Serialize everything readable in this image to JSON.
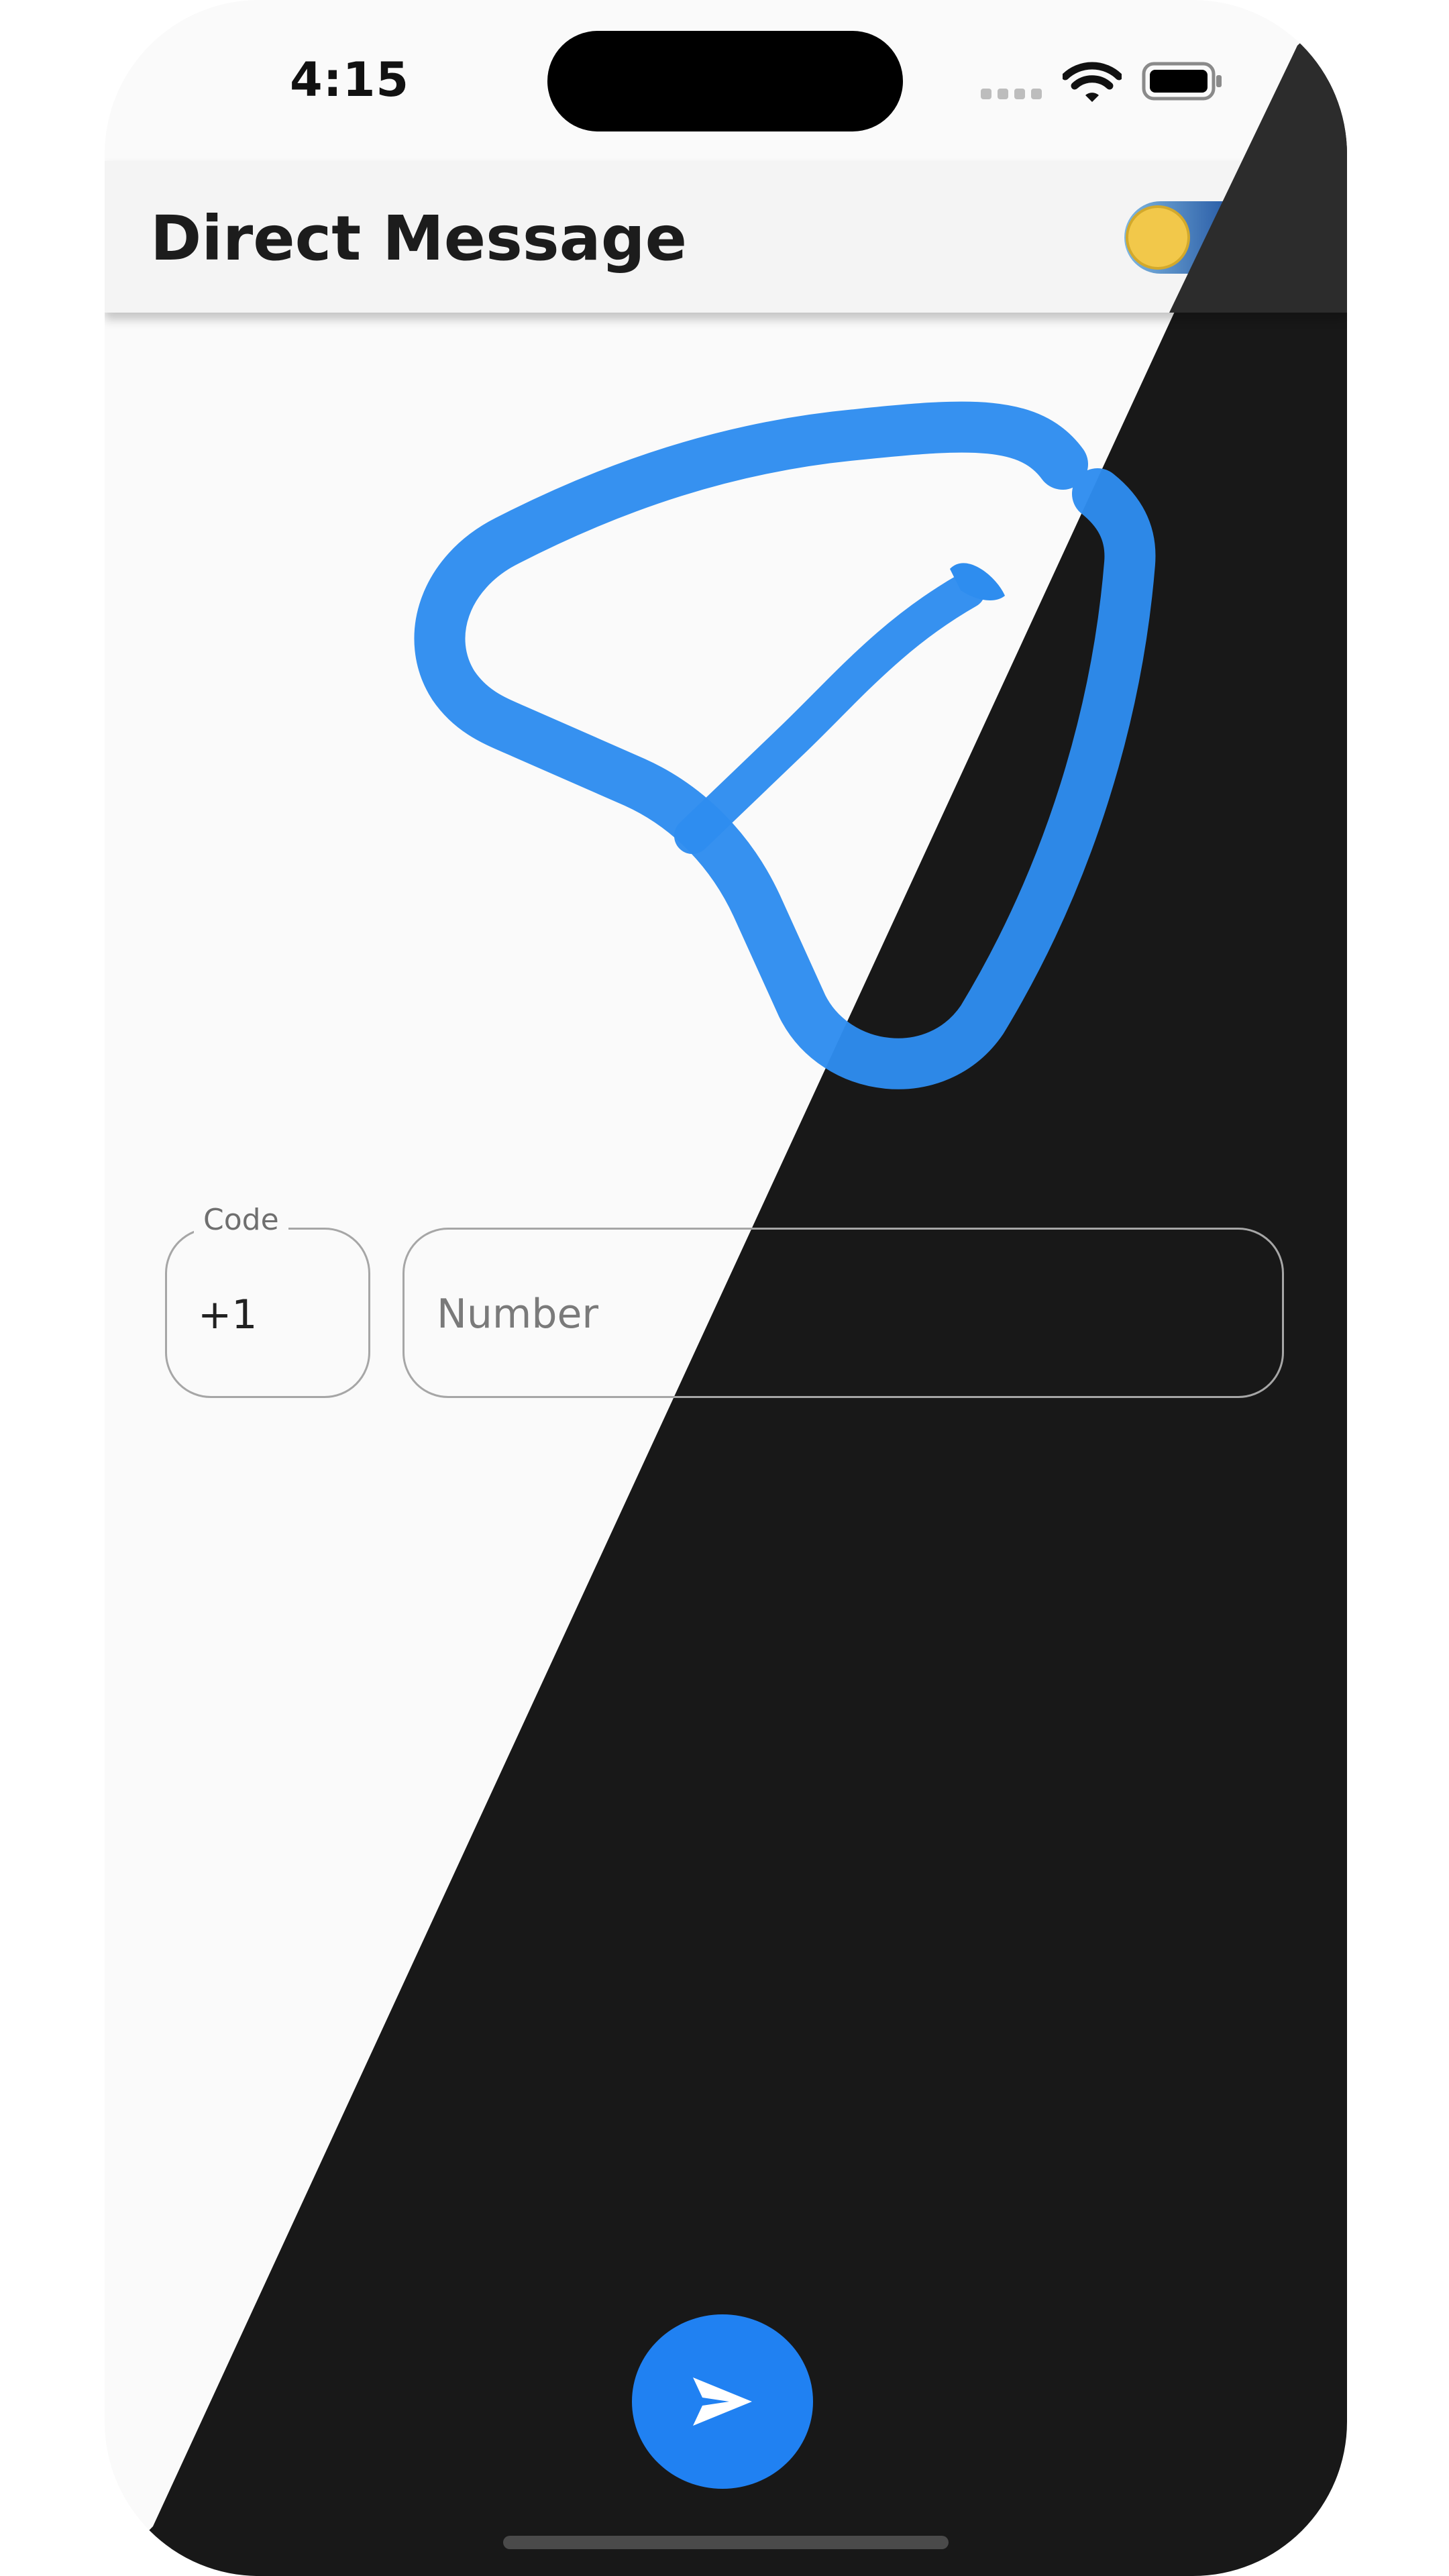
{
  "status_bar": {
    "time": "4:15",
    "signal_icon": "signal-dots-icon",
    "wifi_icon": "wifi-icon",
    "battery_icon": "battery-icon"
  },
  "app_bar": {
    "title": "Direct Message",
    "theme_toggle_icon": "sun-moon-toggle-icon",
    "theme_toggle_state": "light"
  },
  "logo": {
    "icon": "paper-plane-logo-icon",
    "color": "#2E8DEF"
  },
  "form": {
    "code": {
      "label": "Code",
      "value": "+1"
    },
    "number": {
      "placeholder": "Number",
      "value": ""
    }
  },
  "send_button": {
    "icon": "send-icon",
    "color": "#2081F2"
  },
  "colors": {
    "light_background": "#FAFAFA",
    "dark_background": "#181818",
    "accent": "#2081F2"
  }
}
